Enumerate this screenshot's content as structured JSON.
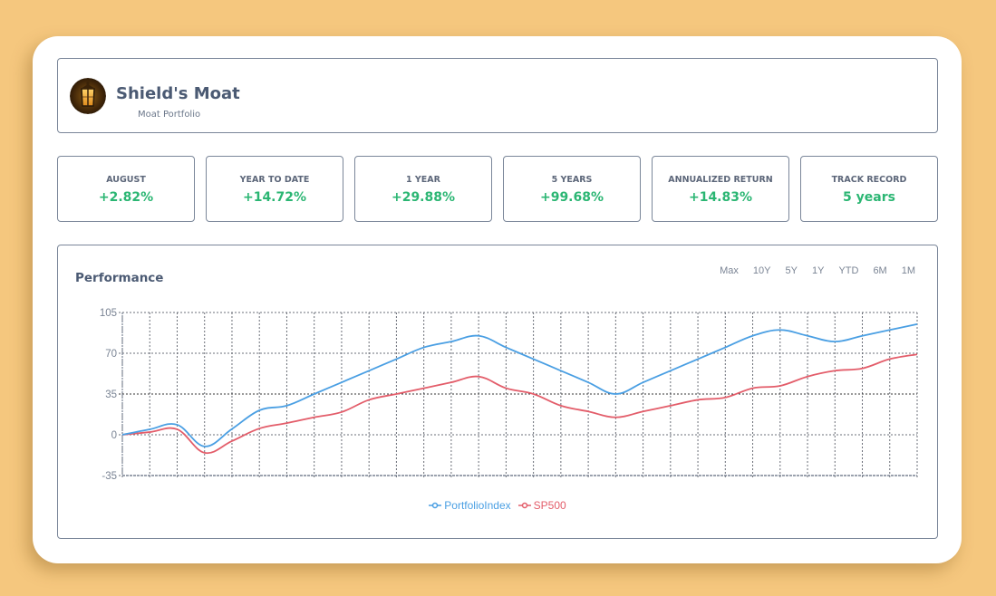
{
  "header": {
    "title": "Shield's Moat",
    "subtitle": "Moat Portfolio",
    "avatar_icon": "lantern-icon"
  },
  "stats": [
    {
      "label": "AUGUST",
      "value": "+2.82%"
    },
    {
      "label": "YEAR TO DATE",
      "value": "+14.72%"
    },
    {
      "label": "1 YEAR",
      "value": "+29.88%"
    },
    {
      "label": "5 YEARS",
      "value": "+99.68%"
    },
    {
      "label": "ANNUALIZED RETURN",
      "value": "+14.83%"
    },
    {
      "label": "TRACK RECORD",
      "value": "5 years"
    }
  ],
  "performance": {
    "title": "Performance",
    "ranges": [
      "Max",
      "10Y",
      "5Y",
      "1Y",
      "YTD",
      "6M",
      "1M"
    ]
  },
  "colors": {
    "positive": "#2bb673",
    "portfolio": "#4a9fe3",
    "sp500": "#e35d6a",
    "text_primary": "#4b5a73"
  },
  "chart_data": {
    "type": "line",
    "title": "Performance",
    "xlabel": "",
    "ylabel": "",
    "ylim": [
      -35,
      105
    ],
    "yticks": [
      105,
      70,
      35,
      0,
      -35
    ],
    "x_count": 30,
    "grid": true,
    "legend_position": "bottom",
    "series": [
      {
        "name": "PortfolioIndex",
        "color": "#4a9fe3",
        "values": [
          0,
          4.7,
          8.6,
          -10,
          5,
          21,
          25,
          35,
          45,
          55,
          65,
          75,
          80,
          85,
          75,
          65,
          55,
          45,
          35,
          45,
          55,
          65,
          75,
          85,
          90,
          85,
          80,
          85,
          90,
          95
        ]
      },
      {
        "name": "SP500",
        "color": "#e35d6a",
        "values": [
          0,
          2.3,
          4.7,
          -15.5,
          -5.4,
          5.4,
          10,
          15,
          19.5,
          30,
          35,
          40,
          45,
          50,
          40,
          35,
          25,
          20,
          15,
          20,
          25,
          30,
          32,
          40,
          42,
          50,
          55,
          57,
          65,
          69
        ]
      }
    ]
  }
}
